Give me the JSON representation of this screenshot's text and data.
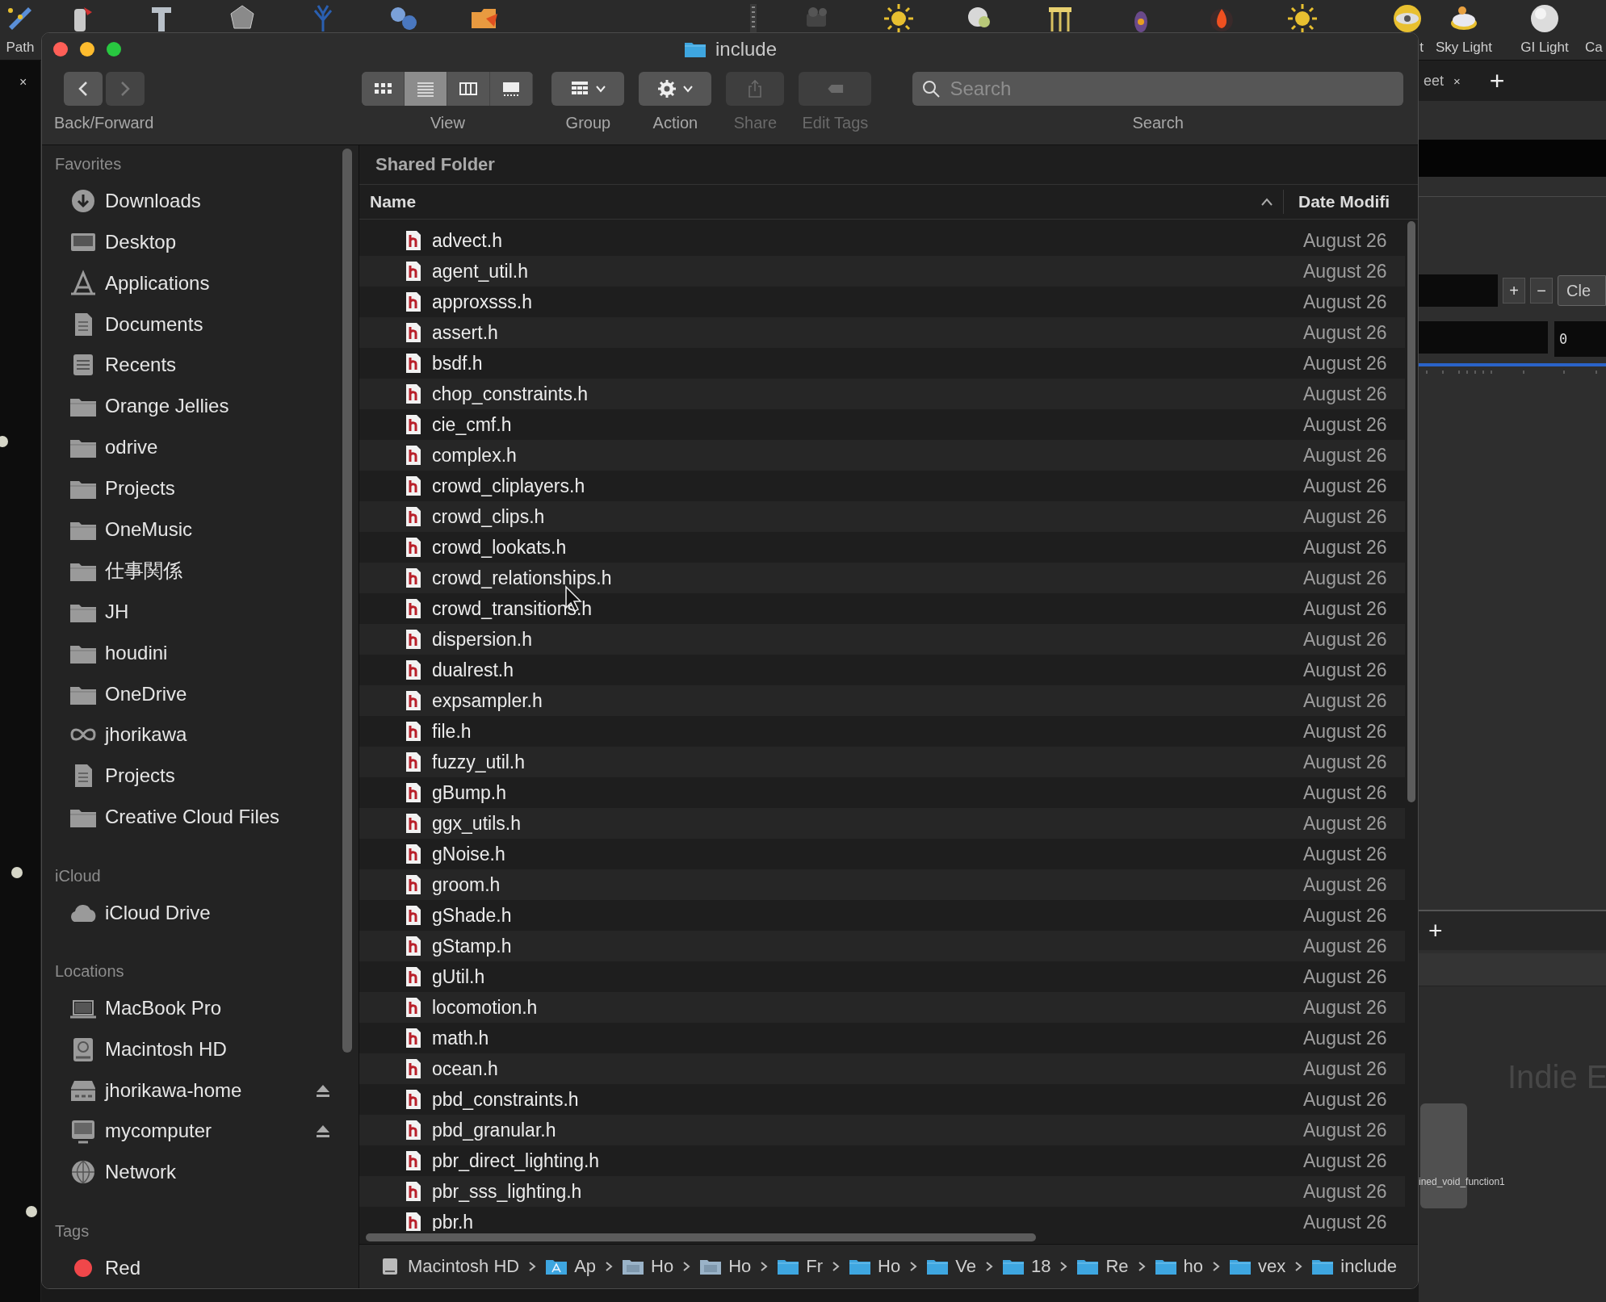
{
  "background_app": {
    "shelf": [
      {
        "kind": "pen",
        "label": "Path"
      },
      {
        "kind": "spray"
      },
      {
        "kind": "letter"
      },
      {
        "kind": "poly"
      },
      {
        "kind": "tree"
      },
      {
        "kind": "spheres"
      },
      {
        "kind": "folder"
      },
      {
        "kind": "grip"
      },
      {
        "kind": "camera"
      },
      {
        "kind": "sun"
      },
      {
        "kind": "spot"
      },
      {
        "kind": "table"
      },
      {
        "kind": "bottle"
      },
      {
        "kind": "fire"
      },
      {
        "kind": "sun"
      },
      {
        "kind": "eye",
        "label": "t",
        "label_cut": true
      },
      {
        "kind": "skylight",
        "label": "Sky Light"
      },
      {
        "kind": "sphere",
        "label": "GI Light"
      },
      {
        "kind": "none",
        "label": "Ca"
      }
    ],
    "left_tab_close": "×",
    "pane_tab": {
      "label": "eet",
      "close": "×"
    },
    "new_tab": "+",
    "parm_buttons": [
      "+",
      "−"
    ],
    "clear_button": "Cle",
    "value_field": "0",
    "add_button": "+",
    "network_label": "Indie E",
    "node_label": "ined_void_function1"
  },
  "window": {
    "title": "include"
  },
  "toolbar": {
    "back_forward": {
      "label": "Back/Forward",
      "back_disabled": false,
      "forward_disabled": true
    },
    "view": {
      "label": "View",
      "modes": [
        {
          "kind": "icons",
          "selected": false
        },
        {
          "kind": "list",
          "selected": true
        },
        {
          "kind": "columns",
          "selected": false
        },
        {
          "kind": "gallery",
          "selected": false
        }
      ]
    },
    "group": {
      "label": "Group"
    },
    "action": {
      "label": "Action"
    },
    "share": {
      "label": "Share",
      "disabled": true
    },
    "edit_tags": {
      "label": "Edit Tags",
      "disabled": true
    },
    "search": {
      "placeholder": "Search",
      "label": "Search"
    }
  },
  "sidebar": [
    {
      "title": "Favorites",
      "items": [
        {
          "label": "Downloads",
          "kind": "download"
        },
        {
          "label": "Desktop",
          "kind": "desktop"
        },
        {
          "label": "Applications",
          "kind": "apps"
        },
        {
          "label": "Documents",
          "kind": "document"
        },
        {
          "label": "Recents",
          "kind": "recents"
        },
        {
          "label": "Orange Jellies",
          "kind": "folder"
        },
        {
          "label": "odrive",
          "kind": "folder"
        },
        {
          "label": "Projects",
          "kind": "folder"
        },
        {
          "label": "OneMusic",
          "kind": "folder"
        },
        {
          "label": "仕事関係",
          "kind": "folder"
        },
        {
          "label": "JH",
          "kind": "folder"
        },
        {
          "label": "houdini",
          "kind": "folder"
        },
        {
          "label": "OneDrive",
          "kind": "folder"
        },
        {
          "label": "jhorikawa",
          "kind": "infinity"
        },
        {
          "label": "Projects",
          "kind": "document"
        },
        {
          "label": "Creative Cloud Files",
          "kind": "folder"
        }
      ]
    },
    {
      "title": "iCloud",
      "items": [
        {
          "label": "iCloud Drive",
          "kind": "cloud"
        }
      ]
    },
    {
      "title": "Locations",
      "items": [
        {
          "label": "MacBook Pro",
          "kind": "laptop",
          "eject": false
        },
        {
          "label": "Macintosh HD",
          "kind": "disk",
          "eject": false
        },
        {
          "label": "jhorikawa-home",
          "kind": "server",
          "eject": true
        },
        {
          "label": "mycomputer",
          "kind": "display",
          "eject": true
        },
        {
          "label": "Network",
          "kind": "globe",
          "eject": false
        }
      ]
    },
    {
      "title": "Tags",
      "items": [
        {
          "label": "Red",
          "kind": "tag",
          "color": "#f0474a"
        }
      ]
    }
  ],
  "file_list": {
    "header": "Shared Folder",
    "columns": [
      {
        "label": "Name",
        "sorted": true
      },
      {
        "label": "Date Modifi",
        "sorted": false
      }
    ],
    "rows": [
      {
        "name": "advect.h",
        "date": "August 26"
      },
      {
        "name": "agent_util.h",
        "date": "August 26"
      },
      {
        "name": "approxsss.h",
        "date": "August 26"
      },
      {
        "name": "assert.h",
        "date": "August 26"
      },
      {
        "name": "bsdf.h",
        "date": "August 26"
      },
      {
        "name": "chop_constraints.h",
        "date": "August 26"
      },
      {
        "name": "cie_cmf.h",
        "date": "August 26"
      },
      {
        "name": "complex.h",
        "date": "August 26"
      },
      {
        "name": "crowd_cliplayers.h",
        "date": "August 26"
      },
      {
        "name": "crowd_clips.h",
        "date": "August 26"
      },
      {
        "name": "crowd_lookats.h",
        "date": "August 26"
      },
      {
        "name": "crowd_relationships.h",
        "date": "August 26"
      },
      {
        "name": "crowd_transitions.h",
        "date": "August 26"
      },
      {
        "name": "dispersion.h",
        "date": "August 26"
      },
      {
        "name": "dualrest.h",
        "date": "August 26"
      },
      {
        "name": "expsampler.h",
        "date": "August 26"
      },
      {
        "name": "file.h",
        "date": "August 26"
      },
      {
        "name": "fuzzy_util.h",
        "date": "August 26"
      },
      {
        "name": "gBump.h",
        "date": "August 26"
      },
      {
        "name": "ggx_utils.h",
        "date": "August 26"
      },
      {
        "name": "gNoise.h",
        "date": "August 26"
      },
      {
        "name": "groom.h",
        "date": "August 26"
      },
      {
        "name": "gShade.h",
        "date": "August 26"
      },
      {
        "name": "gStamp.h",
        "date": "August 26"
      },
      {
        "name": "gUtil.h",
        "date": "August 26"
      },
      {
        "name": "locomotion.h",
        "date": "August 26"
      },
      {
        "name": "math.h",
        "date": "August 26"
      },
      {
        "name": "ocean.h",
        "date": "August 26"
      },
      {
        "name": "pbd_constraints.h",
        "date": "August 26"
      },
      {
        "name": "pbd_granular.h",
        "date": "August 26"
      },
      {
        "name": "pbr_direct_lighting.h",
        "date": "August 26"
      },
      {
        "name": "pbr_sss_lighting.h",
        "date": "August 26"
      },
      {
        "name": "pbr.h",
        "date": "August 26"
      }
    ]
  },
  "path_bar": [
    {
      "label": "Macintosh HD",
      "kind": "disk"
    },
    {
      "label": "Ap",
      "kind": "app"
    },
    {
      "label": "Ho",
      "kind": "grey_folder"
    },
    {
      "label": "Ho",
      "kind": "grey_folder"
    },
    {
      "label": "Fr",
      "kind": "folder"
    },
    {
      "label": "Ho",
      "kind": "folder"
    },
    {
      "label": "Ve",
      "kind": "folder"
    },
    {
      "label": "18",
      "kind": "folder"
    },
    {
      "label": "Re",
      "kind": "folder"
    },
    {
      "label": "ho",
      "kind": "folder"
    },
    {
      "label": "vex",
      "kind": "folder"
    },
    {
      "label": "include",
      "kind": "folder"
    }
  ]
}
